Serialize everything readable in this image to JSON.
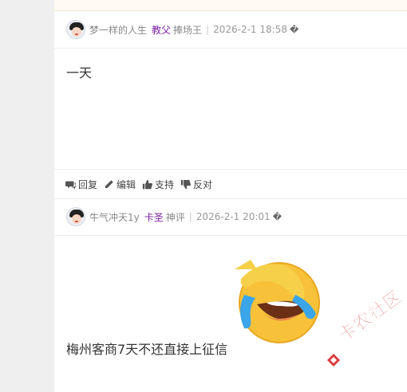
{
  "post1": {
    "username": "梦一样的人生",
    "rank": "教父",
    "title": "捧场王",
    "time": "2026-2-1 18:58",
    "unknown_glyph": "�",
    "content": "一天"
  },
  "actions": {
    "reply": "回复",
    "edit": "编辑",
    "support": "支持",
    "oppose": "反对"
  },
  "post2": {
    "username": "牛气冲天1y",
    "rank": "卡圣",
    "title": "神评",
    "time": "2026-2-1 20:01",
    "unknown_glyph": "�",
    "content": "梅州客商7天不还直接上征信"
  },
  "watermark": {
    "text": "卡农社区"
  },
  "colors": {
    "rank": "#7b1fa2",
    "watermark": "#d93b3b",
    "emoji_face": "#f7c23a"
  },
  "icons": {
    "reply": "comment-icon",
    "edit": "pencil-icon",
    "support": "thumbs-up-icon",
    "oppose": "thumbs-down-icon",
    "emoji": "laughing-crying-emoji"
  }
}
